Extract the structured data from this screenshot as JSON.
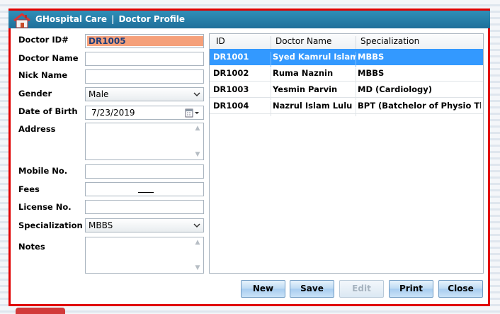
{
  "window": {
    "app_title": "GHospital Care",
    "separator": "|",
    "page_title": "Doctor Profile"
  },
  "form": {
    "doctor_id": {
      "label": "Doctor ID#",
      "value": "DR1005"
    },
    "doctor_name": {
      "label": "Doctor Name",
      "value": ""
    },
    "nick_name": {
      "label": "Nick Name",
      "value": ""
    },
    "gender": {
      "label": "Gender",
      "value": "Male"
    },
    "dob": {
      "label": "Date of Birth",
      "value": "7/23/2019"
    },
    "address": {
      "label": "Address",
      "value": ""
    },
    "mobile": {
      "label": "Mobile No.",
      "value": ""
    },
    "fees": {
      "label": "Fees",
      "value": ""
    },
    "license": {
      "label": "License No.",
      "value": ""
    },
    "specialization": {
      "label": "Specialization",
      "value": "MBBS"
    },
    "notes": {
      "label": "Notes",
      "value": ""
    }
  },
  "grid": {
    "columns": [
      "ID",
      "Doctor Name",
      "Specialization"
    ],
    "rows": [
      {
        "id": "DR1001",
        "name": "Syed Kamrul Islam",
        "spec": "MBBS",
        "selected": true
      },
      {
        "id": "DR1002",
        "name": "Ruma Naznin",
        "spec": "MBBS"
      },
      {
        "id": "DR1003",
        "name": "Yesmin Parvin",
        "spec": "MD (Cardiology)"
      },
      {
        "id": "DR1004",
        "name": "Nazrul Islam Lulu",
        "spec": "BPT (Batchelor of Physio The..."
      }
    ]
  },
  "buttons": {
    "new": "New",
    "save": "Save",
    "edit": "Edit",
    "print": "Print",
    "close": "Close"
  },
  "icons": {
    "home": "home-icon",
    "dropdown": "chevron-down-icon",
    "calendar": "calendar-icon"
  },
  "colors": {
    "frame": "#e00000",
    "titlebar": "#2a83ad",
    "selection": "#3399ff",
    "id_highlight": "#f5a07a"
  }
}
